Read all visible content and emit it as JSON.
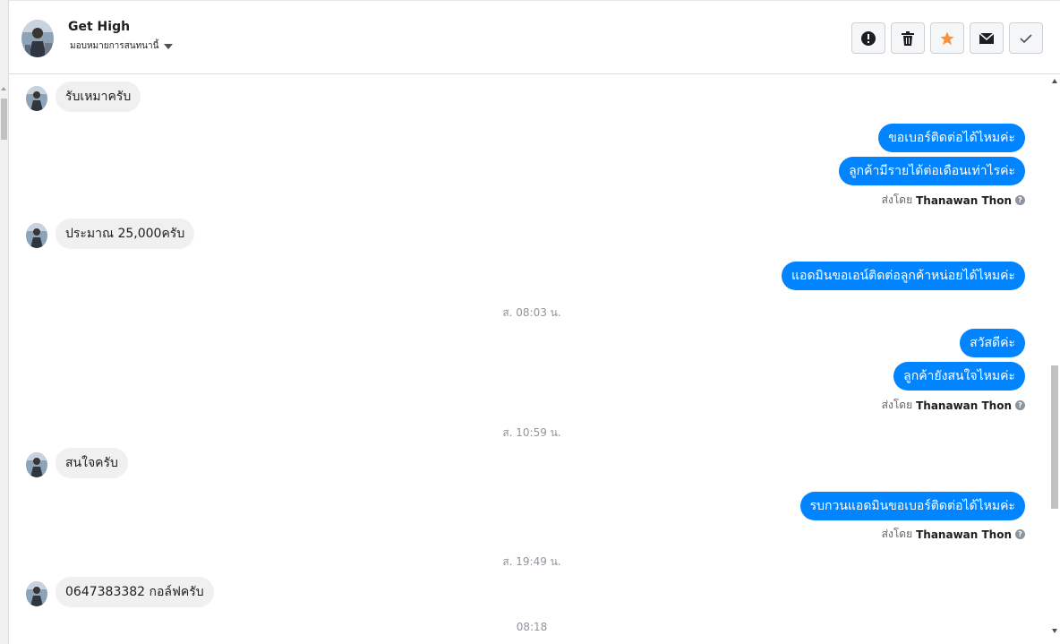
{
  "header": {
    "contact_name": "Get High",
    "assign_label": "มอบหมายการสนทนานี้",
    "actions": [
      {
        "name": "spam",
        "icon": "alert-icon"
      },
      {
        "name": "delete",
        "icon": "trash-icon"
      },
      {
        "name": "star",
        "icon": "star-icon"
      },
      {
        "name": "mark-unread",
        "icon": "envelope-icon"
      },
      {
        "name": "done",
        "icon": "check-icon"
      }
    ]
  },
  "colors": {
    "outgoing_bubble": "#0084ff",
    "incoming_bubble": "#f1f0f0",
    "star": "#f7923a"
  },
  "messages": {
    "m1": "รับเหมาครับ",
    "m2": "ขอเบอร์ติดต่อได้ไหมค่ะ",
    "m3": "ลูกค้ามีรายได้ต่อเดือนเท่าไรค่ะ",
    "m4": "ประมาณ 25,000ครับ",
    "m5": "แอดมินขอเอน์ติดต่อลูกค้าหน่อยได้ไหมค่ะ",
    "m6": "สวัสดีค่ะ",
    "m7": "ลูกค้ายังสนใจไหมค่ะ",
    "m8": "สนใจครับ",
    "m9": "รบกวนแอดมินขอเบอร์ติดต่อได้ไหมค่ะ",
    "m10": "0647383382 กอล์ฟครับ"
  },
  "sent_by": {
    "prefix": "ส่งโดย",
    "agent": "Thanawan Thon"
  },
  "timestamps": {
    "t1": "ส. 08:03 น.",
    "t2": "ส. 10:59 น.",
    "t3": "ส. 19:49 น.",
    "t4": "08:18"
  }
}
